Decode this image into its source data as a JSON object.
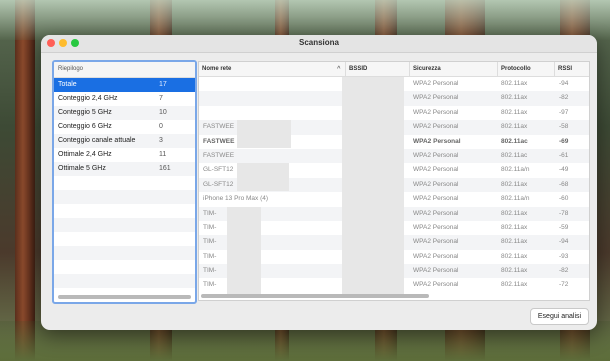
{
  "window": {
    "title": "Scansiona"
  },
  "summary": {
    "header": "Riepilogo",
    "items": [
      {
        "label": "Totale",
        "value": "17",
        "selected": true
      },
      {
        "label": "Conteggio 2,4 GHz",
        "value": "7"
      },
      {
        "label": "Conteggio 5 GHz",
        "value": "10"
      },
      {
        "label": "Conteggio 6 GHz",
        "value": "0"
      },
      {
        "label": "Conteggio canale attuale",
        "value": "3"
      },
      {
        "label": "Ottimale 2,4 GHz",
        "value": "11"
      },
      {
        "label": "Ottimale 5 GHz",
        "value": "161"
      }
    ]
  },
  "table": {
    "columns": [
      "Nome rete",
      "BSSID",
      "Sicurezza",
      "Protocollo",
      "RSSI"
    ],
    "rows": [
      {
        "name": "",
        "security": "WPA2 Personal",
        "protocol": "802.11ax",
        "rssi": "-94"
      },
      {
        "name": "",
        "security": "WPA2 Personal",
        "protocol": "802.11ax",
        "rssi": "-82"
      },
      {
        "name": "",
        "security": "WPA2 Personal",
        "protocol": "802.11ax",
        "rssi": "-97"
      },
      {
        "name": "FASTWEE",
        "security": "WPA2 Personal",
        "protocol": "802.11ax",
        "rssi": "-58"
      },
      {
        "name": "FASTWEE",
        "security": "WPA2 Personal",
        "protocol": "802.11ac",
        "rssi": "-69",
        "bold": true
      },
      {
        "name": "FASTWEE",
        "security": "WPA2 Personal",
        "protocol": "802.11ac",
        "rssi": "-61"
      },
      {
        "name": "GL-SFT12",
        "security": "WPA2 Personal",
        "protocol": "802.11a/n",
        "rssi": "-49"
      },
      {
        "name": "GL-SFT12",
        "security": "WPA2 Personal",
        "protocol": "802.11ax",
        "rssi": "-68"
      },
      {
        "name": "iPhone 13 Pro Max (4)",
        "security": "WPA2 Personal",
        "protocol": "802.11a/n",
        "rssi": "-60"
      },
      {
        "name": "TIM-",
        "security": "WPA2 Personal",
        "protocol": "802.11ax",
        "rssi": "-78"
      },
      {
        "name": "TIM-",
        "security": "WPA2 Personal",
        "protocol": "802.11ax",
        "rssi": "-59"
      },
      {
        "name": "TIM-",
        "security": "WPA2 Personal",
        "protocol": "802.11ax",
        "rssi": "-94"
      },
      {
        "name": "TIM-",
        "security": "WPA2 Personal",
        "protocol": "802.11ax",
        "rssi": "-93"
      },
      {
        "name": "TIM-",
        "security": "WPA2 Personal",
        "protocol": "802.11ax",
        "rssi": "-82"
      },
      {
        "name": "TIM-",
        "security": "WPA2 Personal",
        "protocol": "802.11ax",
        "rssi": "-72"
      }
    ]
  },
  "actions": {
    "scan_label": "Esegui analisi"
  },
  "icons": {
    "sort": "sort-chevron-up-icon"
  },
  "colors": {
    "selection": "#1a6fe3",
    "focus_ring": "#7aa7e8"
  }
}
